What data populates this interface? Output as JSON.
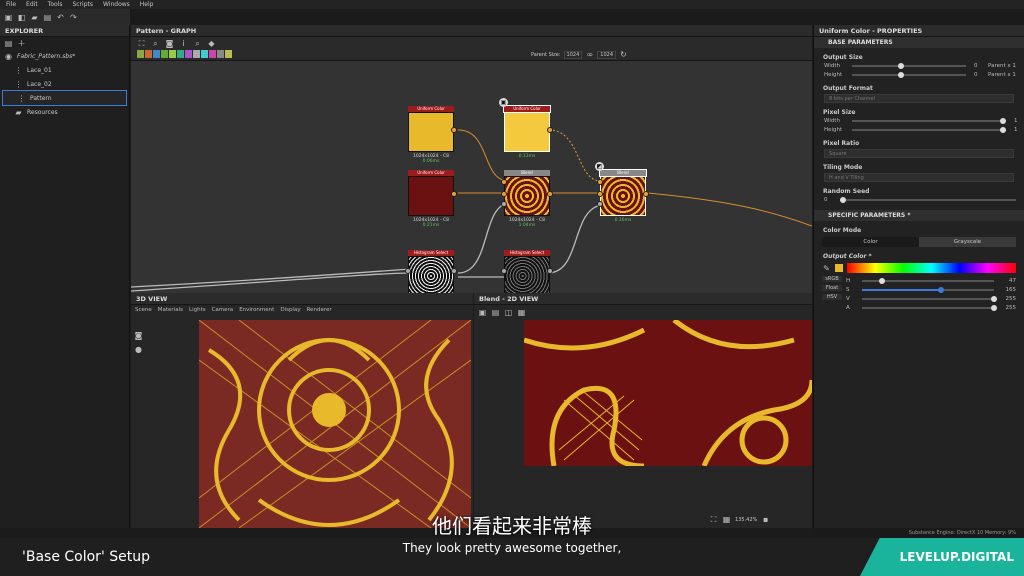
{
  "menu": [
    "File",
    "Edit",
    "Tools",
    "Scripts",
    "Windows",
    "Help"
  ],
  "explorer": {
    "title": "EXPLORER",
    "file": "Fabric_Pattern.sbs*",
    "items": [
      "Lace_01",
      "Lace_02",
      "Pattern",
      "Resources"
    ]
  },
  "graph": {
    "title": "Pattern - GRAPH",
    "parent_size_label": "Parent Size:",
    "parent_size_value": "1024",
    "size_value": "1024",
    "nodes": [
      {
        "title": "Uniform Color",
        "caption": "1024x1024 - C8",
        "time": "0.06ms"
      },
      {
        "title": "Uniform Color",
        "caption": "",
        "time": "0.13ms"
      },
      {
        "title": "Uniform Color",
        "caption": "1024x1024 - C8",
        "time": "0.21ms"
      },
      {
        "title": "Blend",
        "caption": "1024x1024 - C8",
        "time": "1.04ms"
      },
      {
        "title": "Blend",
        "caption": "",
        "time": "0.16ms"
      },
      {
        "title": "Histogram Select",
        "caption": "",
        "time": ""
      },
      {
        "title": "Histogram Select",
        "caption": "",
        "time": ""
      }
    ]
  },
  "view3d": {
    "title": "3D VIEW",
    "tabs": [
      "Scene",
      "Materials",
      "Lights",
      "Camera",
      "Environment",
      "Display",
      "Renderer"
    ]
  },
  "view2d": {
    "title": "Blend - 2D VIEW",
    "zoom": "135.42%"
  },
  "properties": {
    "title": "Uniform Color - PROPERTIES",
    "base_section": "BASE PARAMETERS",
    "output_size": "Output Size",
    "width_label": "Width",
    "height_label": "Height",
    "width_value": "0",
    "height_value": "0",
    "width_rel": "Parent x 1",
    "height_rel": "Parent x 1",
    "output_format": "Output Format",
    "output_format_value": "8 bits per Channel",
    "pixel_size": "Pixel Size",
    "px_width_value": "1",
    "px_height_value": "1",
    "pixel_ratio": "Pixel Ratio",
    "pixel_ratio_value": "Square",
    "tiling_mode": "Tiling Mode",
    "tiling_value": "H and V Tiling",
    "random_seed": "Random Seed",
    "random_seed_value": "0",
    "specific_section": "SPECIFIC PARAMETERS *",
    "color_mode": "Color Mode",
    "color_btn": "Color",
    "grayscale_btn": "Grayscale",
    "output_color": "Output Color *",
    "modes": [
      "sRGB",
      "Float",
      "HSV"
    ],
    "channels": [
      {
        "label": "H",
        "value": "47",
        "frac": 0.15
      },
      {
        "label": "S",
        "value": "165",
        "frac": 0.6
      },
      {
        "label": "V",
        "value": "255",
        "frac": 1.0
      },
      {
        "label": "A",
        "value": "255",
        "frac": 1.0
      }
    ]
  },
  "status": "Substance Engine: DirectX 10   Memory: 9%",
  "subtitle_cn": "他们看起来非常棒",
  "subtitle_en": "They look pretty awesome together,",
  "brand_left": "'Base Color' Setup",
  "brand_right": "LEVELUP.DIGITAL",
  "colors": {
    "gold": "#e8b92b",
    "maroon": "#6b1111",
    "accent": "#3d7ad9",
    "brand": "#19b49b"
  }
}
